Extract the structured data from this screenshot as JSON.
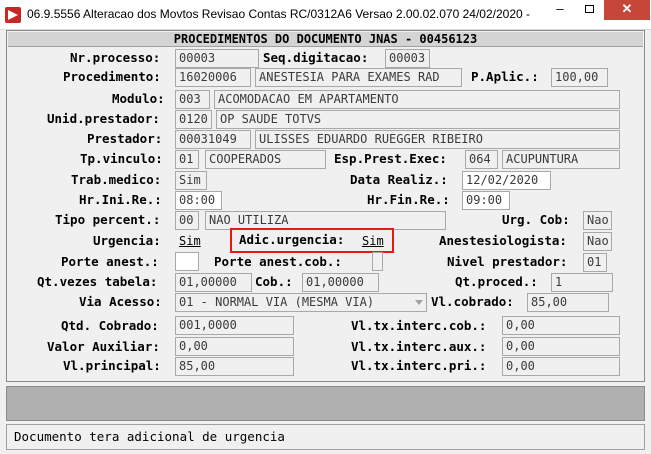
{
  "window": {
    "title": "06.9.5556  Alteracao  dos Movtos Revisao Contas RC/0312A6 Versao 2.00.02.070 24/02/2020 - ",
    "minimize": "–",
    "close": "✕"
  },
  "panel": {
    "header": "PROCEDIMENTOS DO DOCUMENTO JNAS - 00456123"
  },
  "labels": {
    "nr_processo": "Nr.processo:",
    "seq_digitacao": "Seq.digitacao:",
    "procedimento": "Procedimento:",
    "p_aplic": "P.Aplic.:",
    "modulo": "Modulo:",
    "unid_prestador": "Unid.prestador:",
    "prestador": "Prestador:",
    "tp_vinculo": "Tp.vinculo:",
    "esp_prest_exec": "Esp.Prest.Exec:",
    "trab_medico": "Trab.medico:",
    "data_realiz": "Data Realiz.:",
    "hr_ini_re": "Hr.Ini.Re.:",
    "hr_fin_re": "Hr.Fin.Re.:",
    "tipo_percent": "Tipo percent.:",
    "urg_cob": "Urg. Cob:",
    "urgencia": "Urgencia:",
    "adic_urgencia": "Adic.urgencia:",
    "anestesiologista": "Anestesiologista:",
    "porte_anest": "Porte anest.:",
    "porte_anest_cob": "Porte anest.cob.:",
    "nivel_prestador": "Nivel prestador:",
    "qt_vezes_tabela": "Qt.vezes tabela:",
    "cob": "Cob.:",
    "qt_proced": "Qt.proced.:",
    "via_acesso": "Via Acesso:",
    "vl_cobrado": "Vl.cobrado:",
    "qtd_cobrado": "Qtd. Cobrado:",
    "vl_tx_interc_cob": "Vl.tx.interc.cob.:",
    "valor_auxiliar": "Valor Auxiliar:",
    "vl_tx_interc_aux": "Vl.tx.interc.aux.:",
    "vl_principal": "Vl.principal:",
    "vl_tx_interc_pri": "Vl.tx.interc.pri.:"
  },
  "values": {
    "nr_processo": "00003",
    "seq_digitacao": "00003",
    "procedimento_code": "16020006",
    "procedimento_desc": "ANESTESIA PARA EXAMES RAD",
    "p_aplic": "100,00",
    "modulo_code": "003",
    "modulo_desc": "ACOMODACAO EM APARTAMENTO",
    "unid_prestador_code": "0120",
    "unid_prestador_desc": "OP SAUDE TOTVS",
    "prestador_code": "00031049",
    "prestador_desc": "ULISSES EDUARDO RUEGGER RIBEIRO",
    "tp_vinculo_code": "01",
    "tp_vinculo_desc": "COOPERADOS",
    "esp_prest_exec_code": "064",
    "esp_prest_exec_desc": "ACUPUNTURA",
    "trab_medico": "Sim",
    "data_realiz": "12/02/2020",
    "hr_ini_re": "08:00",
    "hr_fin_re": "09:00",
    "tipo_percent_code": "00",
    "tipo_percent_desc": "NAO UTILIZA",
    "urg_cob": "Nao",
    "urgencia": "Sim",
    "adic_urgencia": "Sim",
    "anestesiologista": "Nao",
    "porte_anest": "",
    "porte_anest_cob": "",
    "nivel_prestador": "01",
    "qt_vezes_tabela": "01,00000",
    "cob": "01,00000",
    "qt_proced": "1",
    "via_acesso": "01 - NORMAL VIA (MESMA VIA)",
    "vl_cobrado": "85,00",
    "qtd_cobrado": "001,0000",
    "vl_tx_interc_cob": "0,00",
    "valor_auxiliar": "0,00",
    "vl_tx_interc_aux": "0,00",
    "vl_principal": "85,00",
    "vl_tx_interc_pri": "0,00"
  },
  "status_bar": {
    "message": "Documento tera adicional de urgencia"
  },
  "colors": {
    "highlight": "#e81818",
    "close_button": "#c7463a"
  }
}
